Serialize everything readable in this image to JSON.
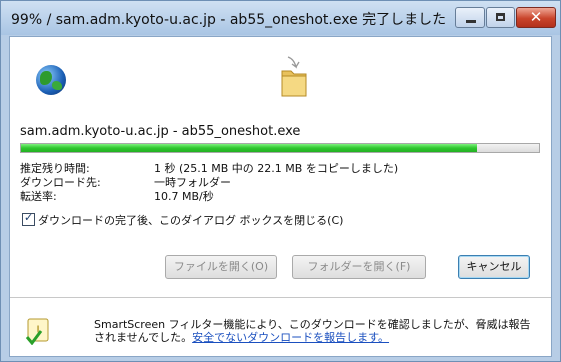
{
  "window": {
    "title": "99% / sam.adm.kyoto-u.ac.jp - ab55_oneshot.exe 完了しました",
    "buttons": {
      "minimize": "",
      "maximize": "",
      "close": "✕"
    }
  },
  "download": {
    "host_file": "sam.adm.kyoto-u.ac.jp - ab55_oneshot.exe",
    "progress_fraction": 0.88,
    "rows": [
      {
        "label": "推定残り時間:",
        "value": "1 秒 (25.1 MB 中の 22.1 MB をコピーしました)"
      },
      {
        "label": "ダウンロード先:",
        "value": "一時フォルダー"
      },
      {
        "label": "転送率:",
        "value": "10.7 MB/秒"
      }
    ],
    "close_when_done": {
      "label": "ダウンロードの完了後、このダイアログ ボックスを閉じる(C)",
      "checked": true
    }
  },
  "buttons": {
    "open_file": "ファイルを開く(O)",
    "open_folder": "フォルダーを開く(F)",
    "cancel": "キャンセル"
  },
  "smartscreen": {
    "line1": "SmartScreen フィルター機能により、このダウンロードを確認しましたが、脅威は報告",
    "line2_prefix": "されませんでした。",
    "line2_link": "安全でないダウンロードを報告します。"
  },
  "icons": {
    "globe": "globe-icon",
    "folder": "folder-icon",
    "shield": "smartscreen-shield-icon"
  },
  "colors": {
    "progress": "#2fc72f",
    "link": "#1a4fbf"
  }
}
